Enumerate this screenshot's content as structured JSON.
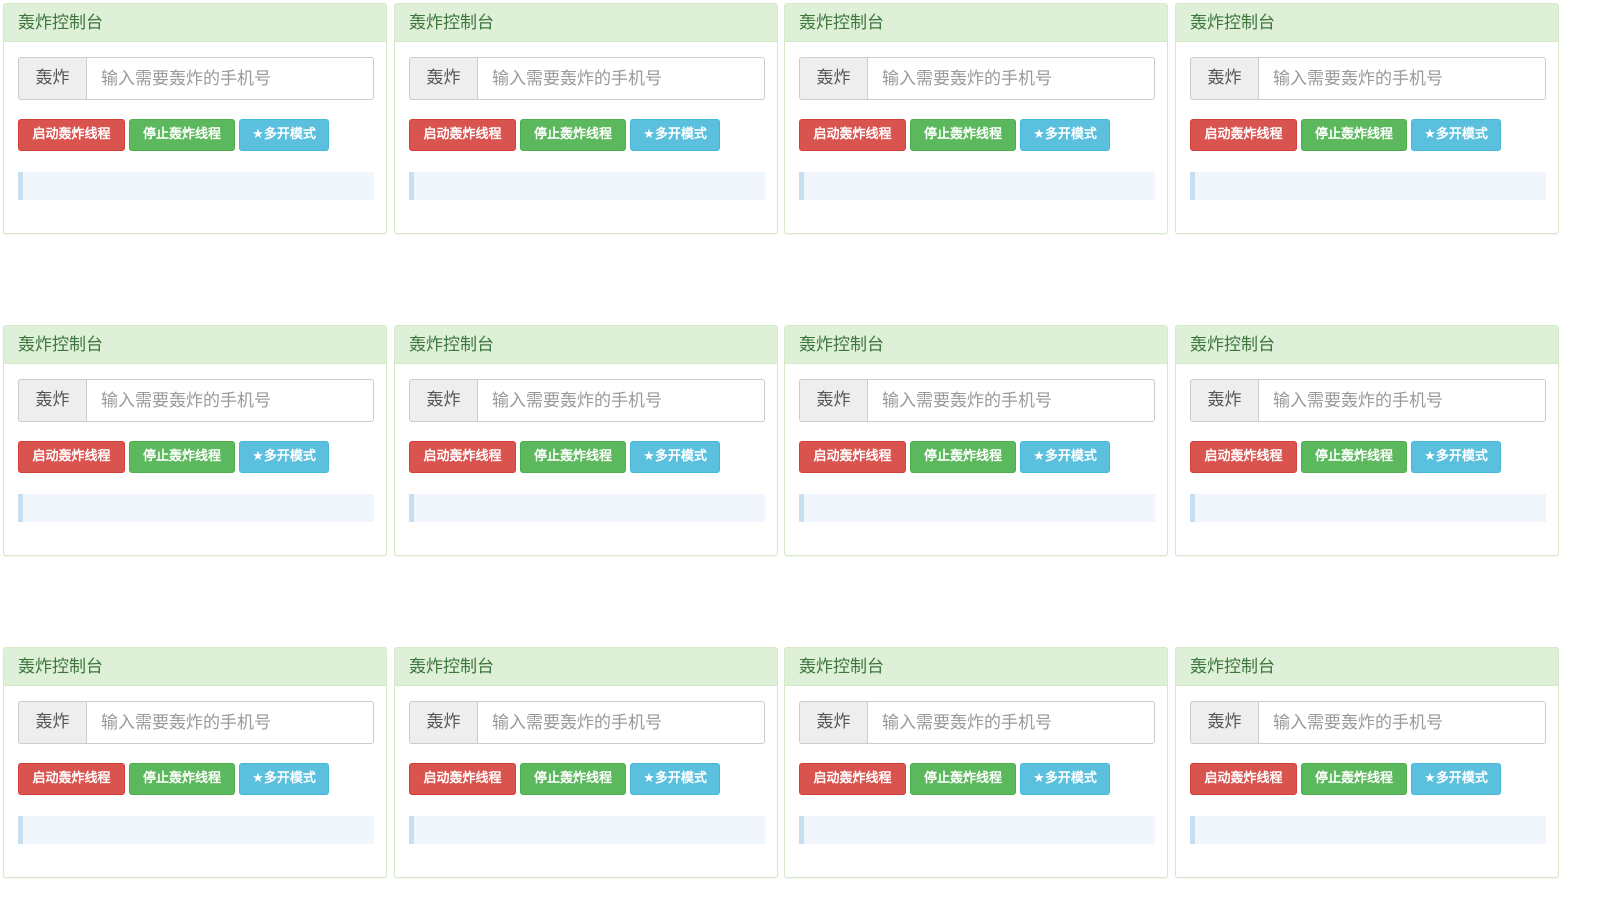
{
  "panel_template": {
    "title": "轰炸控制台",
    "addon_label": "轰炸",
    "input_placeholder": "输入需要轰炸的手机号",
    "input_value": "",
    "start_label": "启动轰炸线程",
    "stop_label": "停止轰炸线程",
    "multi_label": "★多开模式",
    "log_text": ""
  },
  "grid": {
    "rows": 3,
    "cols": 4
  },
  "colors": {
    "heading_bg": "#dff0d8",
    "heading_text": "#3c763d",
    "start_button": "#d9534f",
    "stop_button": "#5cb85c",
    "multi_button": "#5bc0de",
    "log_bg": "#f0f6fc",
    "log_accent": "#c7dff1"
  }
}
